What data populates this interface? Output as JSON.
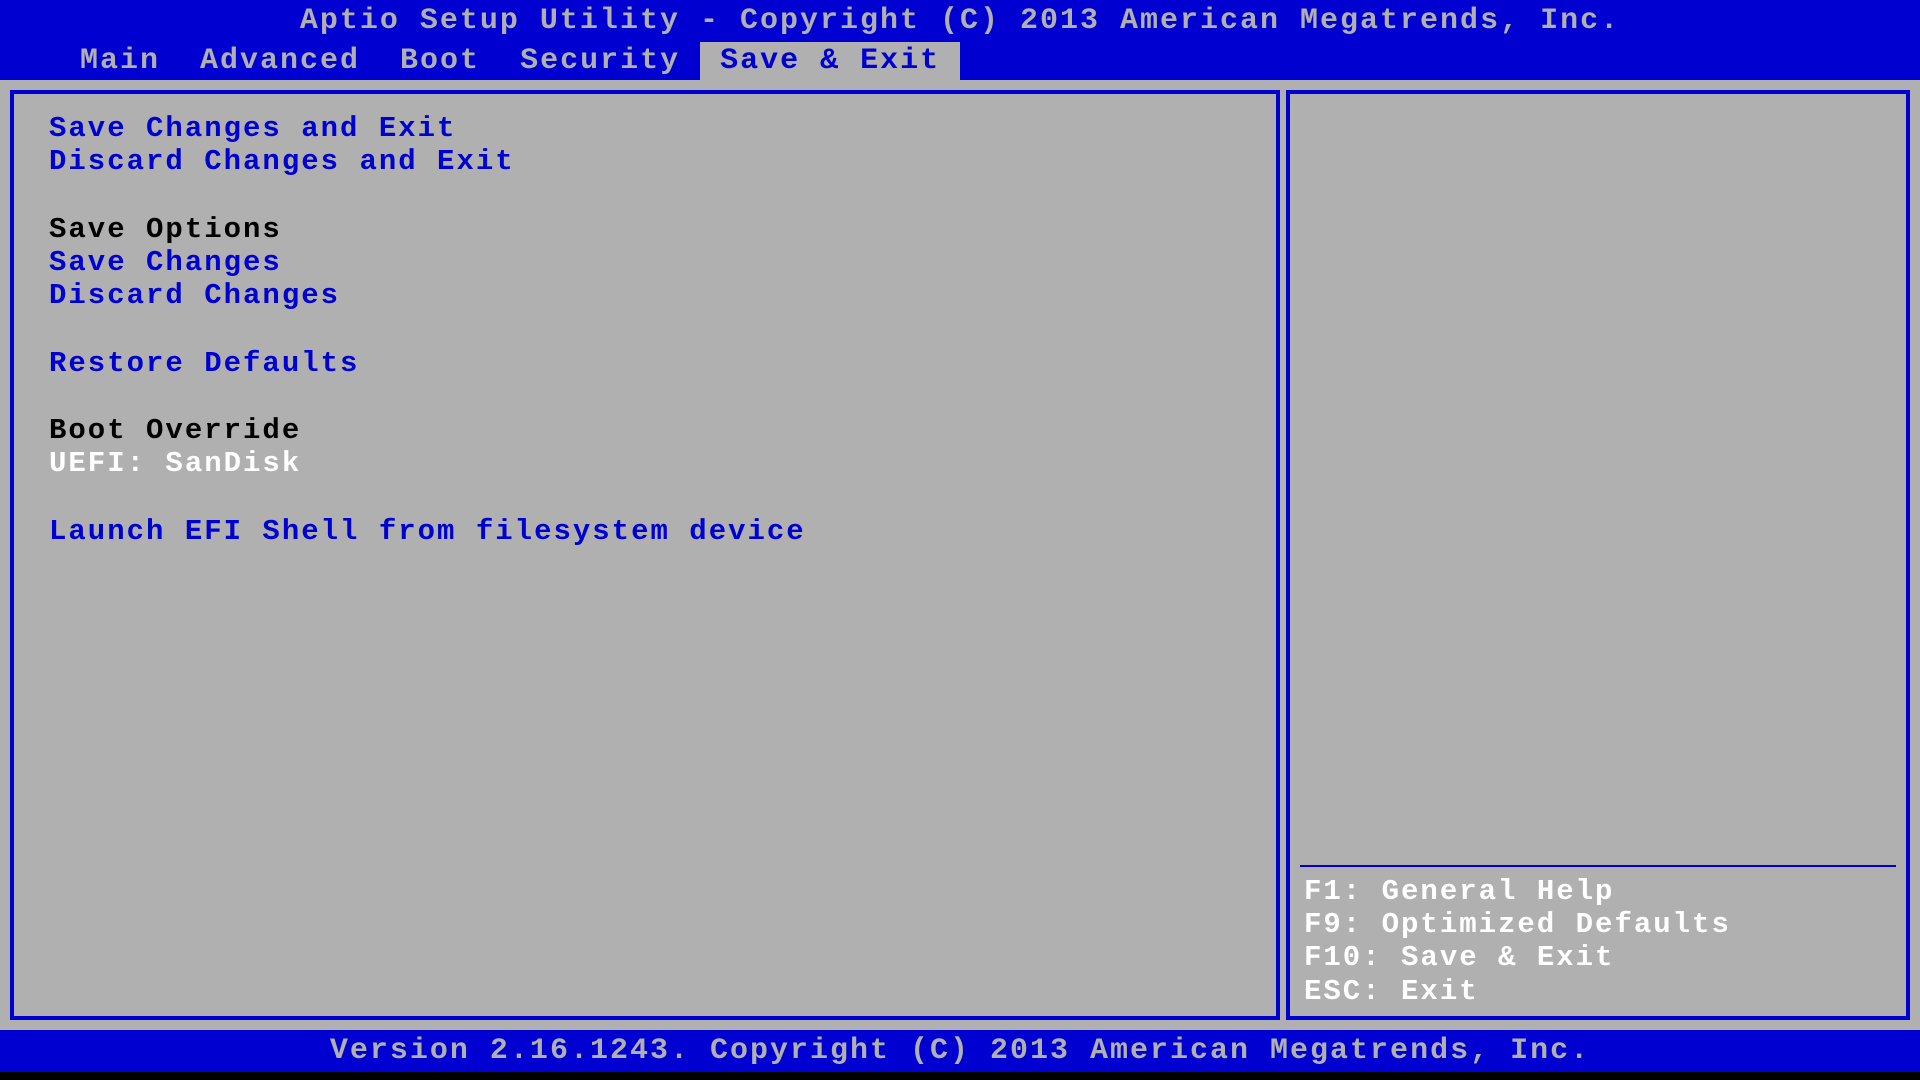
{
  "header": {
    "title": "Aptio Setup Utility - Copyright (C) 2013 American Megatrends, Inc."
  },
  "tabs": {
    "items": [
      {
        "label": "Main",
        "active": false
      },
      {
        "label": "Advanced",
        "active": false
      },
      {
        "label": "Boot",
        "active": false
      },
      {
        "label": "Security",
        "active": false
      },
      {
        "label": "Save & Exit",
        "active": true
      }
    ]
  },
  "menu": {
    "save_changes_exit": "Save Changes and Exit",
    "discard_changes_exit": "Discard Changes and Exit",
    "save_options_header": "Save Options",
    "save_changes": "Save Changes",
    "discard_changes": "Discard Changes",
    "restore_defaults": "Restore Defaults",
    "boot_override_header": "Boot Override",
    "uefi_sandisk": "UEFI: SanDisk",
    "launch_efi_shell": "Launch EFI Shell from filesystem device"
  },
  "help": {
    "f1": "F1: General Help",
    "f9": "F9: Optimized Defaults",
    "f10": "F10: Save & Exit",
    "esc": "ESC: Exit"
  },
  "footer": {
    "version": "Version 2.16.1243. Copyright (C) 2013 American Megatrends, Inc."
  }
}
